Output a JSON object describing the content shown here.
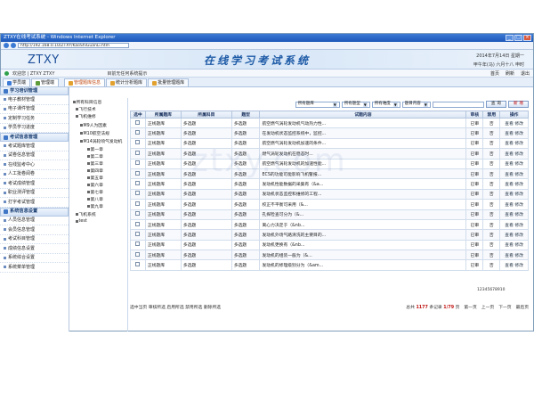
{
  "browser": {
    "title": "ZTXY在线考试系统 - Windows Internet Explorer",
    "address": "http://192.168.0.10/ZTXY/KaoShiGuanLi.htm"
  },
  "banner": {
    "logo": "ZTXY",
    "system_title": "在线学习考试系统",
    "date": "2014年7月14日 星期一",
    "lunar": "甲午年(马) 六月十八 申时"
  },
  "infobar": {
    "greeting": "欢迎您 | ZTXY ZTXY",
    "notice": "目前无任何系统提示",
    "links": [
      "首页",
      "刷新",
      "退出"
    ]
  },
  "main_tabs": [
    "学员端",
    "管理端"
  ],
  "content_tabs": [
    "管理题库信息",
    "统计分析题库",
    "批量管理题库"
  ],
  "sidebar": [
    {
      "title": "学习培训管理",
      "items": [
        "电子教材管理",
        "电子课件管理",
        "定制学习任务",
        "学员学习进度"
      ]
    },
    {
      "title": "考试信息管理",
      "items": [
        "考试题库管理",
        "试卷信息管理",
        "在线监考中心",
        "人工批卷阅卷",
        "考试成绩管理",
        "职业测评管理",
        "打字考试管理"
      ]
    },
    {
      "title": "系统信息设置",
      "items": [
        "人员信息管理",
        "会员信息管理",
        "考试科目管理",
        "成绩信息设置",
        "系统综合设置",
        "系统菜单管理"
      ]
    }
  ],
  "tree": [
    "所有科目信息",
    "飞行技术",
    "飞机维修",
    "M9人为因素",
    "M10航空法规",
    "M14涡轮喷气发动机",
    "第一章",
    "第二章",
    "第三章",
    "第四章",
    "第五章",
    "第六章",
    "第七章",
    "第八章",
    "第九章",
    "飞机系统",
    "test"
  ],
  "filters": {
    "bank": "所有题库",
    "type": "所有题型",
    "difficulty": "所有难度",
    "content": "题目内容",
    "search_label": "查 询",
    "add_label": "新 增"
  },
  "columns": [
    "选中",
    "所属题库",
    "所属科目",
    "题型",
    "试题内容",
    "审核",
    "禁用",
    "操作"
  ],
  "rows": [
    {
      "bank": "正线题库",
      "subject": "多选题",
      "type": "多选题",
      "content": "航空燃气涡轮发动机气动热力性...",
      "audit": "已审",
      "disabled": "否",
      "ops": "查看 修改"
    },
    {
      "bank": "正线题库",
      "subject": "多选题",
      "type": "多选题",
      "content": "在发动机状态监控系统中，监控...",
      "audit": "已审",
      "disabled": "否",
      "ops": "查看 修改"
    },
    {
      "bank": "正线题库",
      "subject": "多选题",
      "type": "多选题",
      "content": "航空燃气涡轮发动机加速的条件...",
      "audit": "已审",
      "disabled": "否",
      "ops": "查看 修改"
    },
    {
      "bank": "正线题库",
      "subject": "多选题",
      "type": "多选题",
      "content": "燃气涡轮发动机在稳态时...",
      "audit": "已审",
      "disabled": "否",
      "ops": "查看 修改"
    },
    {
      "bank": "正线题库",
      "subject": "多选题",
      "type": "多选题",
      "content": "航空燃气涡轮发动机的加速性能...",
      "audit": "已审",
      "disabled": "否",
      "ops": "查看 修改"
    },
    {
      "bank": "正线题库",
      "subject": "多选题",
      "type": "多选题",
      "content": "ECS的功能可能影响飞机警报...",
      "audit": "已审",
      "disabled": "否",
      "ops": "查看 修改"
    },
    {
      "bank": "正线题库",
      "subject": "多选题",
      "type": "多选题",
      "content": "发动机性能数据的采集有（&a...",
      "audit": "已审",
      "disabled": "否",
      "ops": "查看 修改"
    },
    {
      "bank": "正线题库",
      "subject": "多选题",
      "type": "多选题",
      "content": "发动机状态监控和维修的工程...",
      "audit": "已审",
      "disabled": "否",
      "ops": "查看 修改"
    },
    {
      "bank": "正线题库",
      "subject": "多选题",
      "type": "多选题",
      "content": "校正不平衡可采用（&...",
      "audit": "已审",
      "disabled": "否",
      "ops": "查看 修改"
    },
    {
      "bank": "正线题库",
      "subject": "多选题",
      "type": "多选题",
      "content": "孔探检查可分为（&...",
      "audit": "已审",
      "disabled": "否",
      "ops": "查看 修改"
    },
    {
      "bank": "正线题库",
      "subject": "多选题",
      "type": "多选题",
      "content": "离心力决定于（&nb...",
      "audit": "已审",
      "disabled": "否",
      "ops": "查看 修改"
    },
    {
      "bank": "正线题库",
      "subject": "多选题",
      "type": "多选题",
      "content": "发动机外场气路清洗的主要目的...",
      "audit": "已审",
      "disabled": "否",
      "ops": "查看 修改"
    },
    {
      "bank": "正线题库",
      "subject": "多选题",
      "type": "多选题",
      "content": "发动机更换有（&nb...",
      "audit": "已审",
      "disabled": "否",
      "ops": "查看 修改"
    },
    {
      "bank": "正线题库",
      "subject": "多选题",
      "type": "多选题",
      "content": "发动机的组装一般为（&...",
      "audit": "已审",
      "disabled": "否",
      "ops": "查看 修改"
    },
    {
      "bank": "正线题库",
      "subject": "多选题",
      "type": "多选题",
      "content": "发动机的修理级别分为（&am...",
      "audit": "已审",
      "disabled": "否",
      "ops": "查看 修改"
    }
  ],
  "page_numbers": "12345678910",
  "footer": {
    "bulk_actions": "选中当页 审核所选 启用所选 禁用所选 删除所选",
    "total_prefix": "总共",
    "total_count": "1177",
    "total_mid": "条记录",
    "current_page": "1/79",
    "page_suffix": "页",
    "nav": [
      "第一页",
      "上一页",
      "下一页",
      "最后页"
    ]
  },
  "watermark": "ztxy.com"
}
